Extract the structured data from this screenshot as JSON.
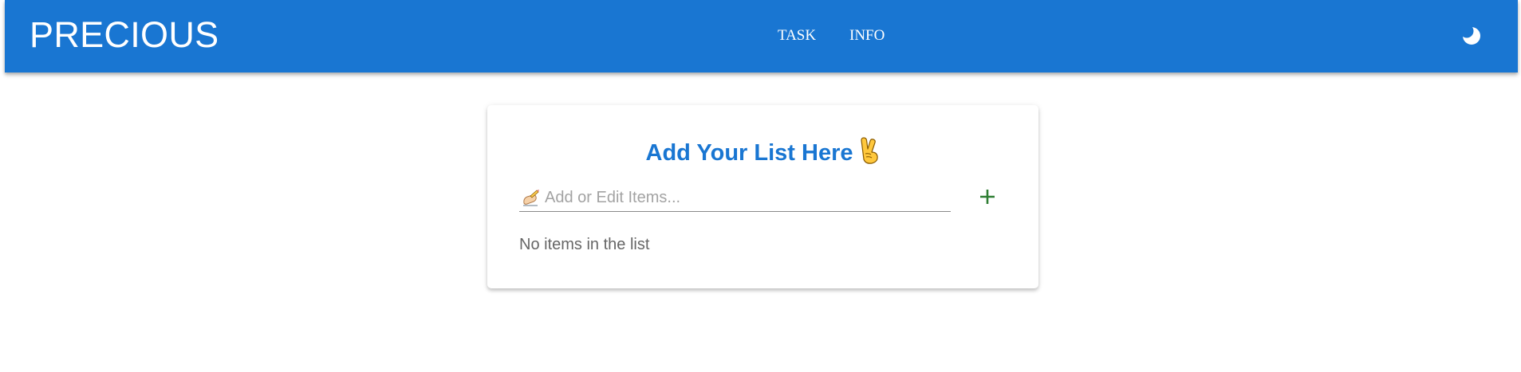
{
  "header": {
    "brand": "PRECIOUS",
    "nav": [
      {
        "label": "TASK"
      },
      {
        "label": "INFO"
      }
    ],
    "theme_toggle_icon": "moon-icon"
  },
  "card": {
    "title": "Add Your List Here",
    "title_icon": "victory-hand-icon",
    "input": {
      "icon": "writing-hand-icon",
      "placeholder": "Add or Edit Items...",
      "value": ""
    },
    "add_icon": "plus-icon",
    "empty_message": "No items in the list"
  },
  "colors": {
    "primary": "#1976d2",
    "add": "#2e7d32",
    "muted_text": "#666666",
    "placeholder": "#a3a3a3"
  }
}
